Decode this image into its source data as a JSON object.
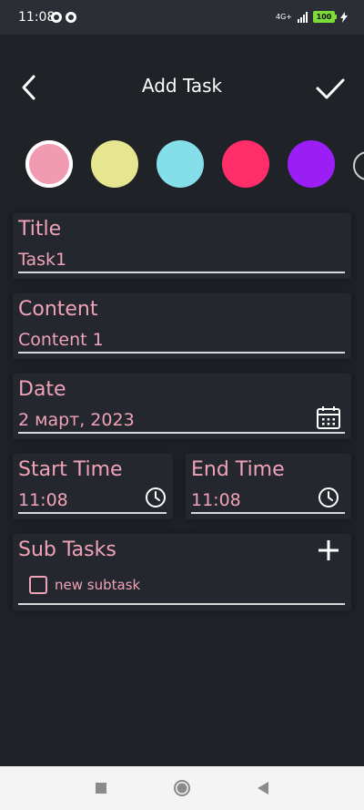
{
  "status_bar": {
    "time": "11:08",
    "network": "4G+",
    "battery": "100"
  },
  "header": {
    "title": "Add Task",
    "back_icon": "chevron-left-icon",
    "confirm_icon": "check-icon"
  },
  "color_options": [
    {
      "color": "#f29ab2",
      "selected": true
    },
    {
      "color": "#e6e690"
    },
    {
      "color": "#85dfea"
    },
    {
      "color": "#ff2e6b"
    },
    {
      "color": "#9a1ef5"
    }
  ],
  "form": {
    "title_label": "Title",
    "title_value": "Task1",
    "content_label": "Content",
    "content_value": "Content 1",
    "date_label": "Date",
    "date_value": "2 март, 2023",
    "start_time_label": "Start Time",
    "start_time_value": "11:08",
    "end_time_label": "End Time",
    "end_time_value": "11:08",
    "subtasks_label": "Sub Tasks",
    "subtask_placeholder": "new subtask"
  },
  "colors": {
    "accent_pink": "#f0a3b7",
    "background": "#1f2227",
    "card": "#24272d"
  }
}
